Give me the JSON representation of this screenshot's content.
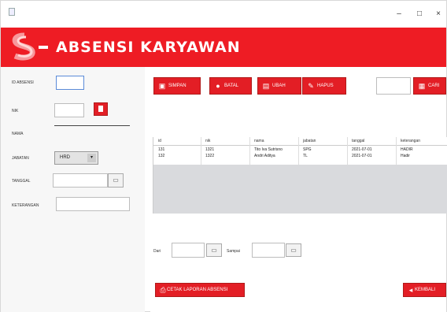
{
  "window": {
    "controls": {
      "minimize": "–",
      "maximize": "□",
      "close": "×"
    }
  },
  "header": {
    "title": "ABSENSI KARYAWAN",
    "logo_icon": "company-logo-s",
    "accent_color": "#ee1c24"
  },
  "form": {
    "id_absensi_label": "ID ABSENSI",
    "id_absensi_value": "",
    "nik_label": "NIK",
    "nik_value": "",
    "nama_label": "NAMA",
    "nama_value": "",
    "jabatan_label": "JABATAN",
    "jabatan_value": "HRD",
    "tanggal_label": "TANGGAL",
    "tanggal_value": "",
    "keterangan_label": "KETERANGAN",
    "keterangan_value": ""
  },
  "toolbar": {
    "simpan": "SIMPAN",
    "batal": "BATAL",
    "ubah": "UBAH",
    "hapus": "HAPUS",
    "cari_value": "",
    "cari": "CARI"
  },
  "table": {
    "columns": [
      "id",
      "nik",
      "nama",
      "jabatan",
      "tanggal",
      "keterangan"
    ],
    "rows": [
      [
        "131",
        "1321",
        "Tito Iva Sutrisno",
        "SPG",
        "2021-07-01",
        "HADIR"
      ],
      [
        "132",
        "1322",
        "Andri Aditya",
        "TL",
        "2021-07-01",
        "Hadir"
      ]
    ]
  },
  "report": {
    "dari_label": "Dari",
    "dari_value": "",
    "sampai_label": "Sampai",
    "sampai_value": "",
    "cetak": "CETAK LAPORAN ABSENSI",
    "kembali": "KEMBALI"
  }
}
